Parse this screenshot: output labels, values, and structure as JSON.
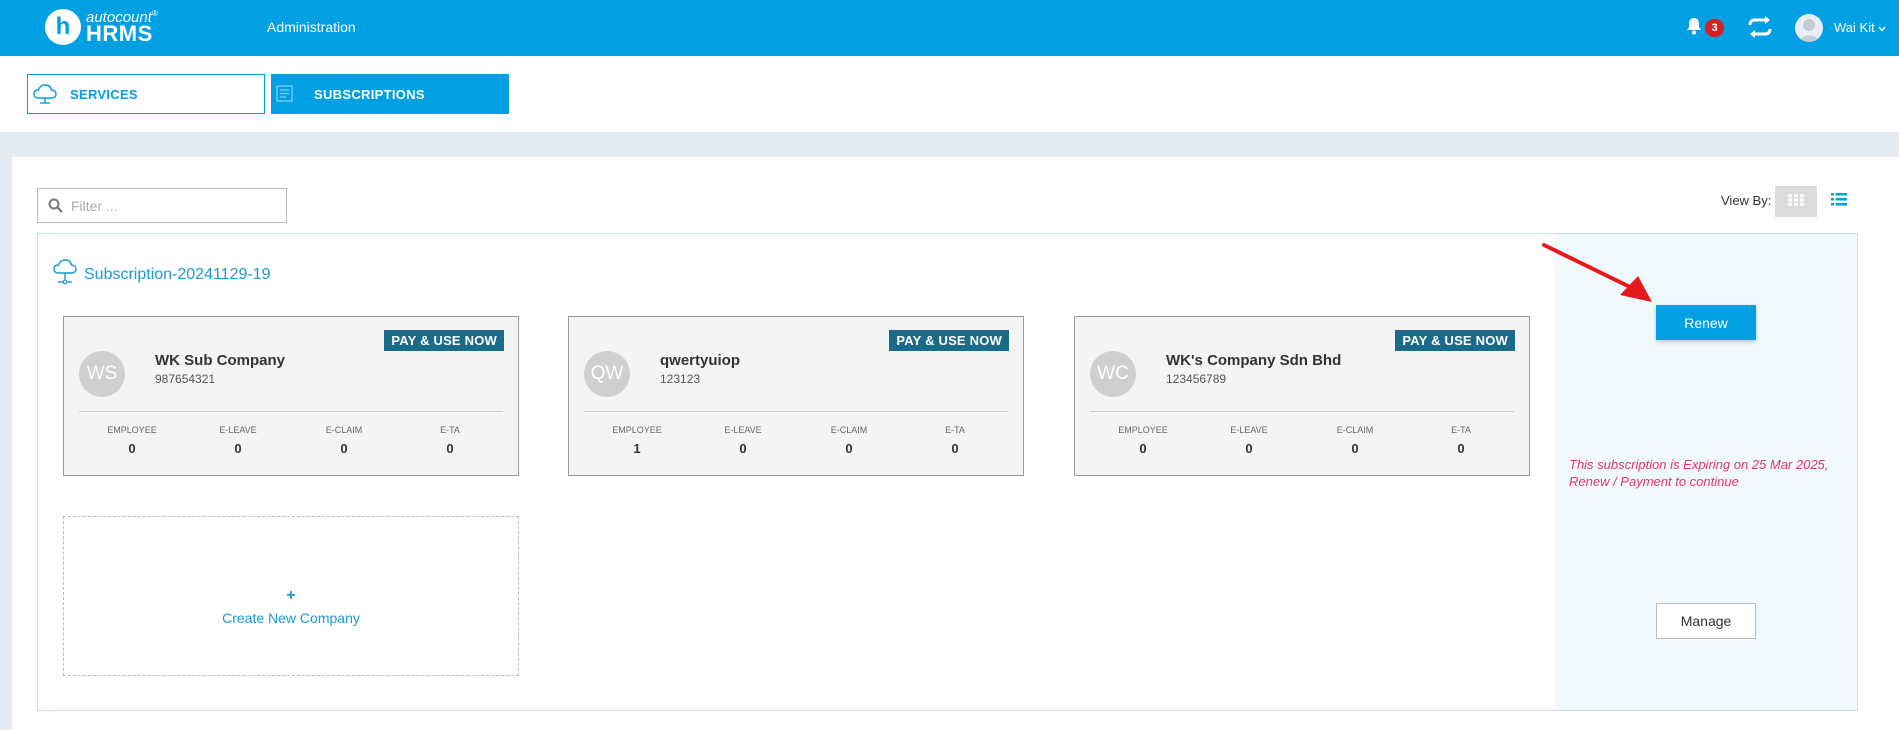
{
  "header": {
    "logo_top": "autocount",
    "logo_bottom": "HRMS",
    "logo_letter": "h",
    "logo_mark": "®",
    "nav_admin": "Administration",
    "notification_count": "3",
    "user_name": "Wai Kit",
    "icons": {
      "bell": "bell-icon",
      "sync": "sync-icon",
      "avatar": "user-avatar-icon",
      "caret": "chevron-down-icon"
    }
  },
  "tabs": [
    {
      "label": "SERVICES",
      "active": false,
      "icon": "cloud-icon"
    },
    {
      "label": "SUBSCRIPTIONS",
      "active": true,
      "icon": "subscription-list-icon"
    }
  ],
  "toolbar": {
    "filter_placeholder": "Filter ...",
    "view_by_label": "View By:",
    "views": [
      "grid-icon",
      "list-icon"
    ]
  },
  "subscription": {
    "title": "Subscription-20241129-19",
    "stat_labels": [
      "EMPLOYEE",
      "E-LEAVE",
      "E-CLAIM",
      "E-TA"
    ],
    "companies": [
      {
        "initials": "WS",
        "name": "WK Sub Company",
        "code": "987654321",
        "badge": "PAY & USE NOW",
        "stats": [
          "0",
          "0",
          "0",
          "0"
        ]
      },
      {
        "initials": "QW",
        "name": "qwertyuiop",
        "code": "123123",
        "badge": "PAY & USE NOW",
        "stats": [
          "1",
          "0",
          "0",
          "0"
        ]
      },
      {
        "initials": "WC",
        "name": "WK's Company Sdn Bhd",
        "code": "123456789",
        "badge": "PAY & USE NOW",
        "stats": [
          "0",
          "0",
          "0",
          "0"
        ]
      }
    ],
    "create_plus": "+",
    "create_label": "Create New Company",
    "renew_label": "Renew",
    "expiry_message": "This subscription is Expiring on 25 Mar 2025, Renew / Payment to continue",
    "manage_label": "Manage"
  },
  "colors": {
    "primary": "#00a0e3",
    "badge_bg": "#1a6a8a",
    "alert_text": "#e3356a",
    "notification_badge": "#d81e1e",
    "arrow": "#e8191e"
  }
}
